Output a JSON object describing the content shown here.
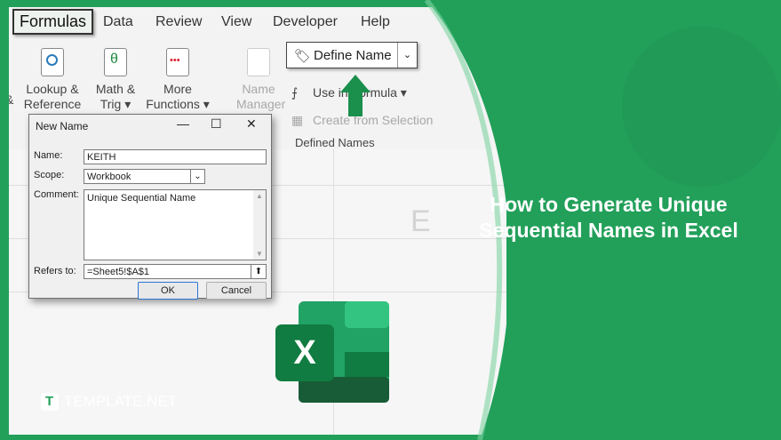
{
  "ribbon": {
    "tabs": [
      "Formulas",
      "Data",
      "Review",
      "View",
      "Developer",
      "Help"
    ],
    "buttons": {
      "lookup": [
        "Lookup &",
        "Reference ▾"
      ],
      "math": [
        "Math &",
        "Trig ▾"
      ],
      "more": [
        "More",
        "Functions ▾"
      ],
      "name_manager": [
        "Name",
        "Manager"
      ],
      "define_name": "Define Name",
      "use_in_formula": "Use in Formula ▾",
      "create_from_selection": "Create from Selection",
      "defined_names_group": "Defined Names",
      "left_cut": "&"
    }
  },
  "sheet": {
    "column_letter": "E"
  },
  "dialog": {
    "title": "New Name",
    "name_label": "Name:",
    "name_value": "KEITH",
    "scope_label": "Scope:",
    "scope_value": "Workbook",
    "comment_label": "Comment:",
    "comment_value": "Unique Sequential Name",
    "refers_label": "Refers to:",
    "refers_value": "=Sheet5!$A$1",
    "ok_label": "OK",
    "cancel_label": "Cancel"
  },
  "promo": {
    "headline_line1": "How to Generate Unique",
    "headline_line2": "Sequential Names in Excel",
    "brand": "TEMPLATE.NET",
    "excel_letter": "X"
  },
  "colors": {
    "brand_green": "#22a05a",
    "excel_dark": "#185c37",
    "excel_mid": "#21a366",
    "arrow": "#1b8f4c"
  }
}
